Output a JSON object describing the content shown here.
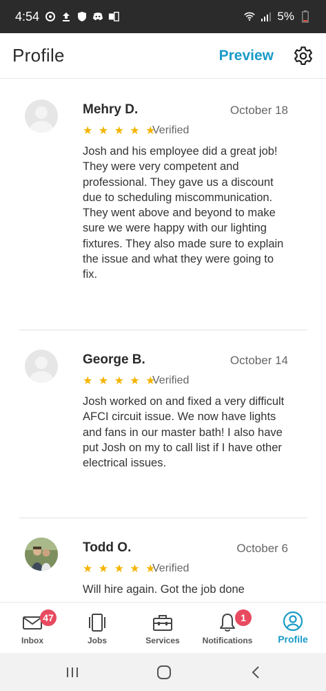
{
  "status_bar": {
    "time": "4:54",
    "battery": "5%",
    "icons": [
      "sync-icon",
      "upload-icon",
      "shield-icon",
      "discord-icon",
      "sim-icon",
      "wifi-icon",
      "signal-icon",
      "battery-icon"
    ]
  },
  "header": {
    "title": "Profile",
    "preview_label": "Preview",
    "settings_icon": "gear-icon"
  },
  "reviews": [
    {
      "name": "Mehry D.",
      "date": "October 18",
      "stars": "★ ★ ★ ★ ★",
      "verified": "Verified",
      "text": "Josh and his employee did a great job! They were very competent and professional. They gave us a discount due to scheduling miscommunication. They went above and beyond to make sure we were happy with our lighting fixtures. They also made sure to explain the issue and what they were going to fix."
    },
    {
      "name": "George B.",
      "date": "October 14",
      "stars": "★ ★ ★ ★ ★",
      "verified": "Verified",
      "text": "Josh worked on and fixed a very difficult AFCI circuit issue. We now have lights and fans in our master bath! I also have put Josh on my to call list if I have other electrical issues."
    },
    {
      "name": "Todd O.",
      "date": "October 6",
      "stars": "★ ★ ★ ★ ★",
      "verified": "Verified",
      "text": "Will hire again. Got the job done"
    }
  ],
  "bottom_nav": {
    "inbox": {
      "label": "Inbox",
      "badge": "47"
    },
    "jobs": {
      "label": "Jobs"
    },
    "services": {
      "label": "Services"
    },
    "notifications": {
      "label": "Notifications",
      "badge": "1"
    },
    "profile": {
      "label": "Profile"
    }
  },
  "colors": {
    "accent": "#1a9bc7",
    "star": "#f4b400",
    "badge": "#e84a5f",
    "status_bar": "#2b2b2b"
  }
}
